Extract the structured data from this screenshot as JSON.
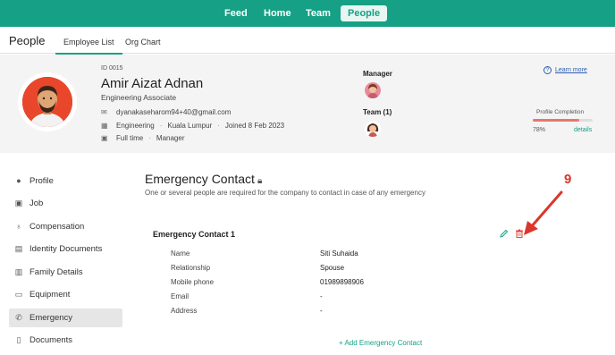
{
  "nav": {
    "items": [
      "Feed",
      "Home",
      "Team",
      "People"
    ],
    "active": "People"
  },
  "subheader": {
    "title": "People",
    "tabs": [
      "Employee List",
      "Org Chart"
    ]
  },
  "profile": {
    "id": "ID 0015",
    "name": "Amir Aizat Adnan",
    "role": "Engineering Associate",
    "email": "dyanakaseharom94+40@gmail.com",
    "department": "Engineering",
    "location": "Kuala Lumpur",
    "joined": "Joined 8 Feb 2023",
    "employment_type": "Full time",
    "position": "Manager",
    "manager_label": "Manager",
    "team_label": "Team (1)",
    "learn_more": "Learn more",
    "completion_label": "Profile Completion",
    "completion_pct": "78%",
    "completion_value": 0.78,
    "details_link": "details"
  },
  "sidebar": {
    "items": [
      {
        "label": "Profile",
        "icon": "person-icon"
      },
      {
        "label": "Job",
        "icon": "briefcase-icon"
      },
      {
        "label": "Compensation",
        "icon": "money-bag-icon"
      },
      {
        "label": "Identity Documents",
        "icon": "id-card-icon"
      },
      {
        "label": "Family Details",
        "icon": "family-icon"
      },
      {
        "label": "Equipment",
        "icon": "laptop-icon"
      },
      {
        "label": "Emergency",
        "icon": "phone-icon"
      },
      {
        "label": "Documents",
        "icon": "document-icon"
      }
    ],
    "active": "Emergency"
  },
  "main": {
    "title": "Emergency Contact",
    "subtitle": "One or several people are required for the company to contact in case of any emergency",
    "contact_title": "Emergency Contact 1",
    "fields": [
      {
        "label": "Name",
        "value": "Siti Suhaida"
      },
      {
        "label": "Relationship",
        "value": "Spouse"
      },
      {
        "label": "Mobile phone",
        "value": "01989898906"
      },
      {
        "label": "Email",
        "value": "-"
      },
      {
        "label": "Address",
        "value": "-"
      }
    ],
    "add_link": "+ Add Emergency Contact"
  },
  "annotation": {
    "number": "9"
  },
  "colors": {
    "brand": "#16a085",
    "delete": "#e0453a",
    "annotation": "#d9372b"
  }
}
